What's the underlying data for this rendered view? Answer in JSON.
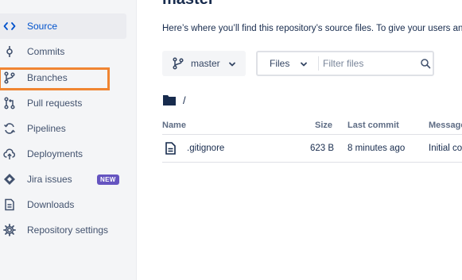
{
  "sidebar": {
    "items": [
      {
        "label": "Source",
        "icon": "code-icon",
        "active": true
      },
      {
        "label": "Commits",
        "icon": "commit-icon"
      },
      {
        "label": "Branches",
        "icon": "branch-icon"
      },
      {
        "label": "Pull requests",
        "icon": "pull-request-icon"
      },
      {
        "label": "Pipelines",
        "icon": "pipelines-icon"
      },
      {
        "label": "Deployments",
        "icon": "deployments-icon"
      },
      {
        "label": "Jira issues",
        "icon": "jira-icon",
        "badge": "NEW"
      },
      {
        "label": "Downloads",
        "icon": "downloads-icon"
      },
      {
        "label": "Repository settings",
        "icon": "gear-icon"
      }
    ]
  },
  "main": {
    "title": "master",
    "description": "Here’s where you’ll find this repository’s source files. To give your users an id",
    "branch_selector": {
      "label": "master"
    },
    "filter": {
      "type_label": "Files",
      "placeholder": "Filter files"
    },
    "path": "/",
    "table": {
      "columns": [
        "Name",
        "Size",
        "Last commit",
        "Message"
      ],
      "rows": [
        {
          "name": ".gitignore",
          "size": "623 B",
          "last_commit": "8 minutes ago",
          "message": "Initial co"
        }
      ]
    }
  },
  "colors": {
    "accent": "#0052cc",
    "highlight_box": "#f08532",
    "badge": "#6554c0",
    "sidebar_bg": "#f4f5f7"
  }
}
